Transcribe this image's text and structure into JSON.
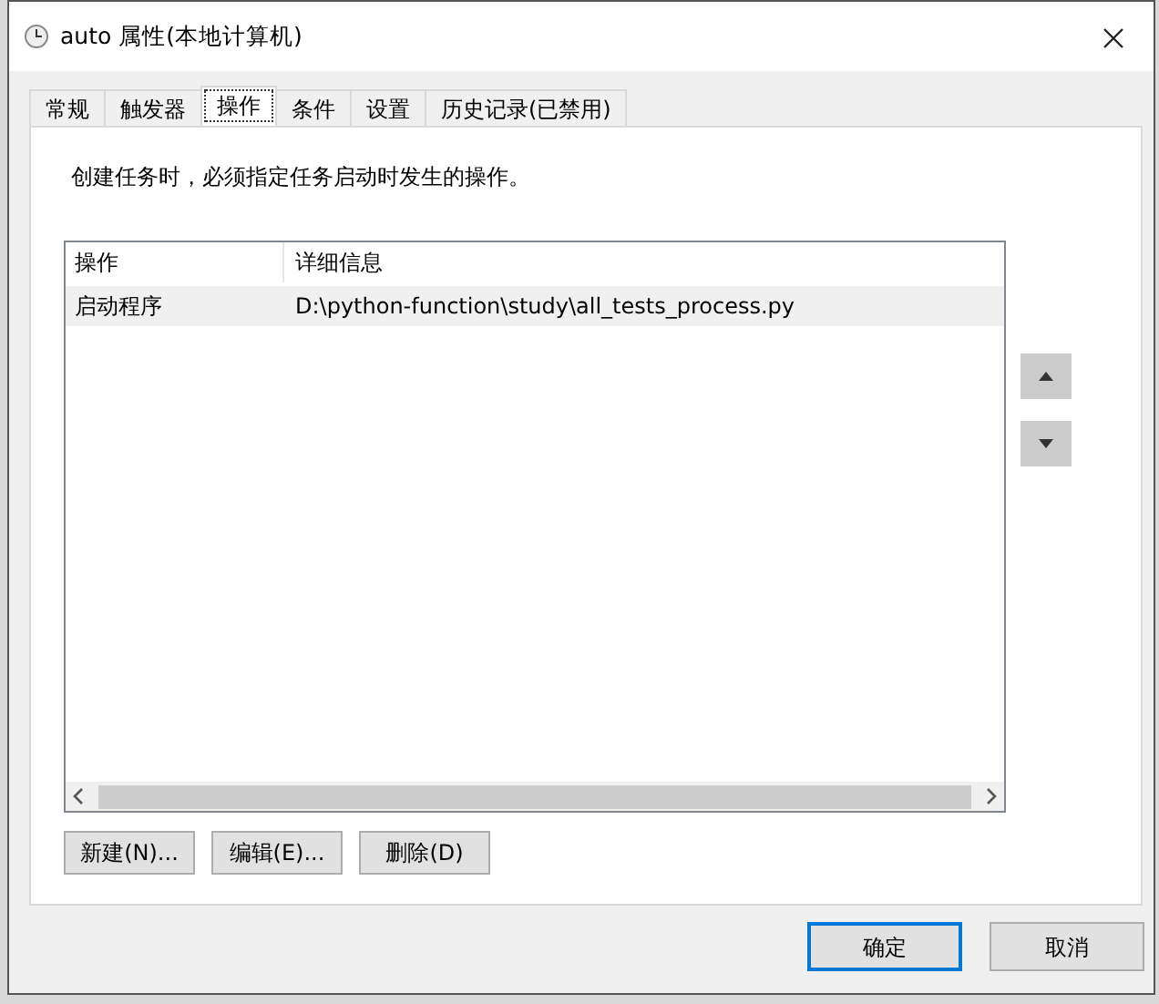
{
  "window": {
    "title": "auto 属性(本地计算机)"
  },
  "tabs": [
    {
      "label": "常规",
      "selected": false
    },
    {
      "label": "触发器",
      "selected": false
    },
    {
      "label": "操作",
      "selected": true
    },
    {
      "label": "条件",
      "selected": false
    },
    {
      "label": "设置",
      "selected": false
    },
    {
      "label": "历史记录(已禁用)",
      "selected": false
    }
  ],
  "description": "创建任务时，必须指定任务启动时发生的操作。",
  "table": {
    "columns": [
      "操作",
      "详细信息"
    ],
    "rows": [
      {
        "cells": [
          "启动程序",
          "D:\\python-function\\study\\all_tests_process.py"
        ],
        "selected": true
      }
    ]
  },
  "action_buttons": [
    "新建(N)...",
    "编辑(E)...",
    "删除(D)"
  ],
  "dialog_buttons": [
    {
      "label": "确定",
      "default": true
    },
    {
      "label": "取消",
      "default": false
    }
  ]
}
